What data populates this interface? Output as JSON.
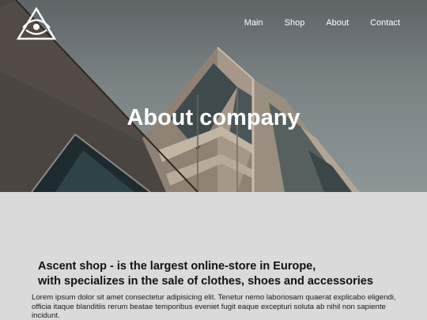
{
  "brand": {
    "logo_icon": "triangle-eye-logo"
  },
  "nav": {
    "items": [
      {
        "label": "Main"
      },
      {
        "label": "Shop"
      },
      {
        "label": "About"
      },
      {
        "label": "Contact"
      }
    ]
  },
  "hero": {
    "title": "About company"
  },
  "content": {
    "headline_line1": "Ascent shop - is the largest online-store in Europe,",
    "headline_line2": "with specializes in the sale of clothes, shoes and accessories",
    "body": "Lorem ipsum dolor sit amet consectetur adipisicing elit. Tenetur nemo laboriosam quaerat explicabo eligendi, officia itaque blanditiis rerum beatae temporibus eveniet fugit eaque excepturi soluta ab nihil non sapiente incidunt."
  },
  "colors": {
    "page_bg": "#dadada",
    "nav_text": "#ffffff",
    "heading_text": "#111111"
  }
}
